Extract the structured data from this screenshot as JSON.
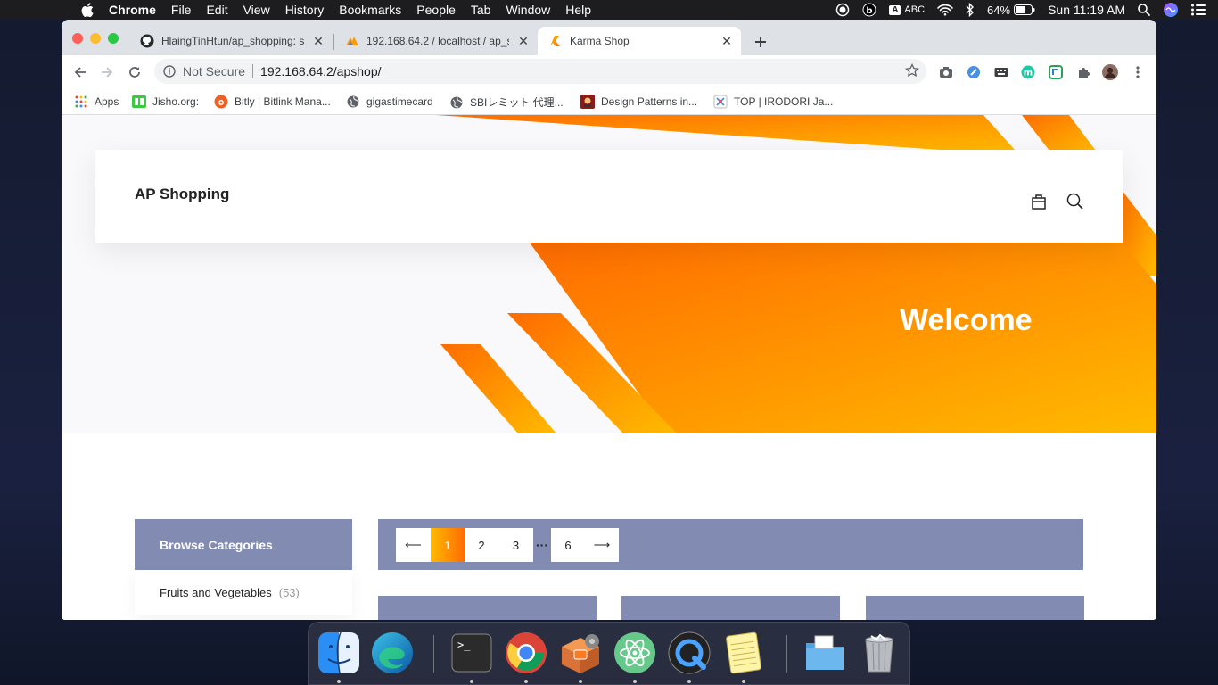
{
  "menubar": {
    "app_name": "Chrome",
    "items": [
      "File",
      "Edit",
      "View",
      "History",
      "Bookmarks",
      "People",
      "Tab",
      "Window",
      "Help"
    ],
    "input_source": "ABC",
    "battery": "64%",
    "clock": "Sun 11:19 AM"
  },
  "tabs": [
    {
      "title": "HlaingTinHtun/ap_shopping: sh",
      "icon": "github-icon"
    },
    {
      "title": "192.168.64.2 / localhost / ap_s",
      "icon": "phpmyadmin-icon"
    },
    {
      "title": "Karma Shop",
      "icon": "karma-icon"
    }
  ],
  "toolbar": {
    "security_label": "Not Secure",
    "url": "192.168.64.2/apshop/"
  },
  "bookmarks": [
    {
      "label": "Apps",
      "icon": "apps-grid-icon"
    },
    {
      "label": "Jisho.org:",
      "icon": "jisho-icon"
    },
    {
      "label": "Bitly | Bitlink Mana...",
      "icon": "bitly-icon"
    },
    {
      "label": "gigastimecard",
      "icon": "globe-icon"
    },
    {
      "label": "SBIレミット 代理...",
      "icon": "globe-icon"
    },
    {
      "label": "Design Patterns in...",
      "icon": "design-patterns-icon"
    },
    {
      "label": "TOP | IRODORI Ja...",
      "icon": "irodori-icon"
    }
  ],
  "page": {
    "logo": "AP Shopping",
    "hero_title": "Welcome",
    "sidebar": {
      "heading": "Browse Categories",
      "categories": [
        {
          "name": "Fruits and Vegetables",
          "count": "(53)"
        }
      ]
    },
    "pagination": {
      "prev": "⟵",
      "pages": [
        "1",
        "2",
        "3",
        "6"
      ],
      "current": "1",
      "ellipsis": "···",
      "next": "⟶"
    }
  },
  "dock": {
    "apps": [
      "finder-icon",
      "edge-icon",
      "terminal-icon",
      "chrome-icon",
      "xampp-icon",
      "atom-icon",
      "quicktime-icon",
      "notes-icon",
      "downloads-folder-icon",
      "trash-icon"
    ]
  },
  "colors": {
    "accent_orange": "#ff6c00",
    "accent_yellow": "#ffba00",
    "filter_bar": "#828bb2"
  }
}
